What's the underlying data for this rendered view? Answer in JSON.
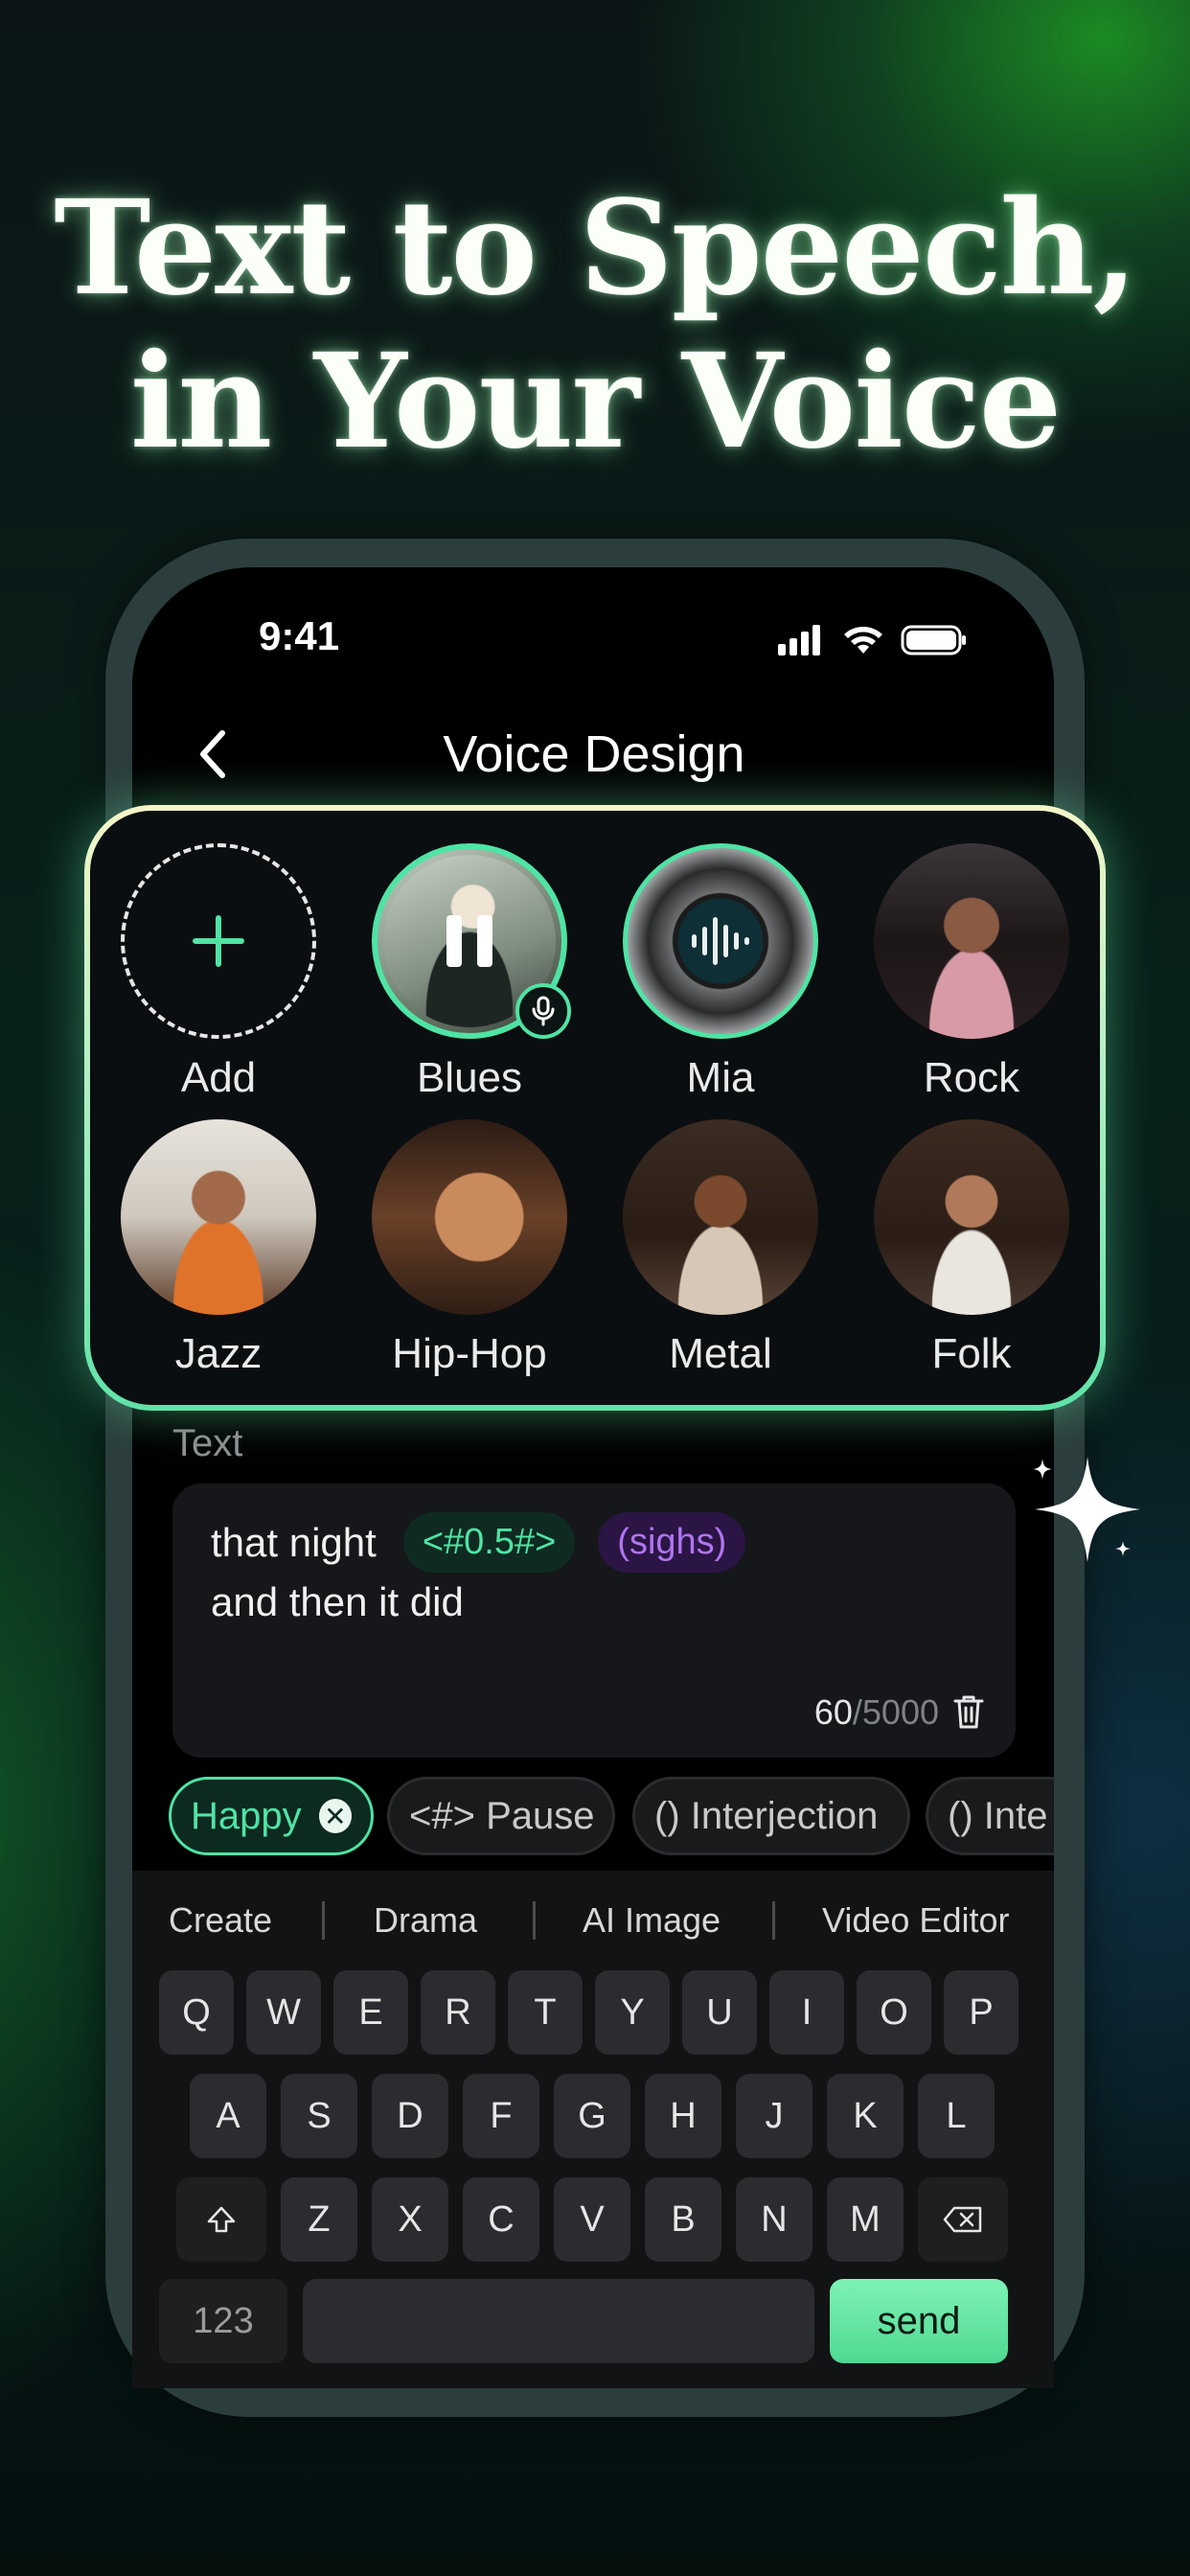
{
  "headline": {
    "line1": "Text to Speech,",
    "line2": "in Your Voice"
  },
  "status_bar": {
    "time": "9:41"
  },
  "nav": {
    "title": "Voice Design"
  },
  "voices": [
    {
      "name": "Add",
      "icon": "plus-icon"
    },
    {
      "name": "Blues",
      "state": "playing",
      "badge": "mic-icon"
    },
    {
      "name": "Mia",
      "icon": "waveform-icon"
    },
    {
      "name": "Rock"
    },
    {
      "name": "Jazz"
    },
    {
      "name": "Hip-Hop"
    },
    {
      "name": "Metal"
    },
    {
      "name": "Folk"
    }
  ],
  "text_section": {
    "label": "Text",
    "line1_text": "that night",
    "pause_tag": "<#0.5#>",
    "sigh_tag": "(sighs)",
    "line2_text": "and then it did",
    "count_current": "60",
    "count_max": "/5000"
  },
  "tags": [
    {
      "label": "Happy",
      "selected": true
    },
    {
      "label": "<#> Pause"
    },
    {
      "label": "() Interjection"
    },
    {
      "label": "() Inte"
    }
  ],
  "keyboard": {
    "suggestions": [
      "Create",
      "Drama",
      "AI Image",
      "Video Editor"
    ],
    "row1": [
      "Q",
      "W",
      "E",
      "R",
      "T",
      "Y",
      "U",
      "I",
      "O",
      "P"
    ],
    "row2": [
      "A",
      "S",
      "D",
      "F",
      "G",
      "H",
      "J",
      "K",
      "L"
    ],
    "row3": [
      "Z",
      "X",
      "C",
      "V",
      "B",
      "N",
      "M"
    ],
    "numbers_key": "123",
    "send_key": "send"
  },
  "colors": {
    "accent": "#4fe3a4",
    "sigh": "#b074f0",
    "background": "#071a1c"
  }
}
